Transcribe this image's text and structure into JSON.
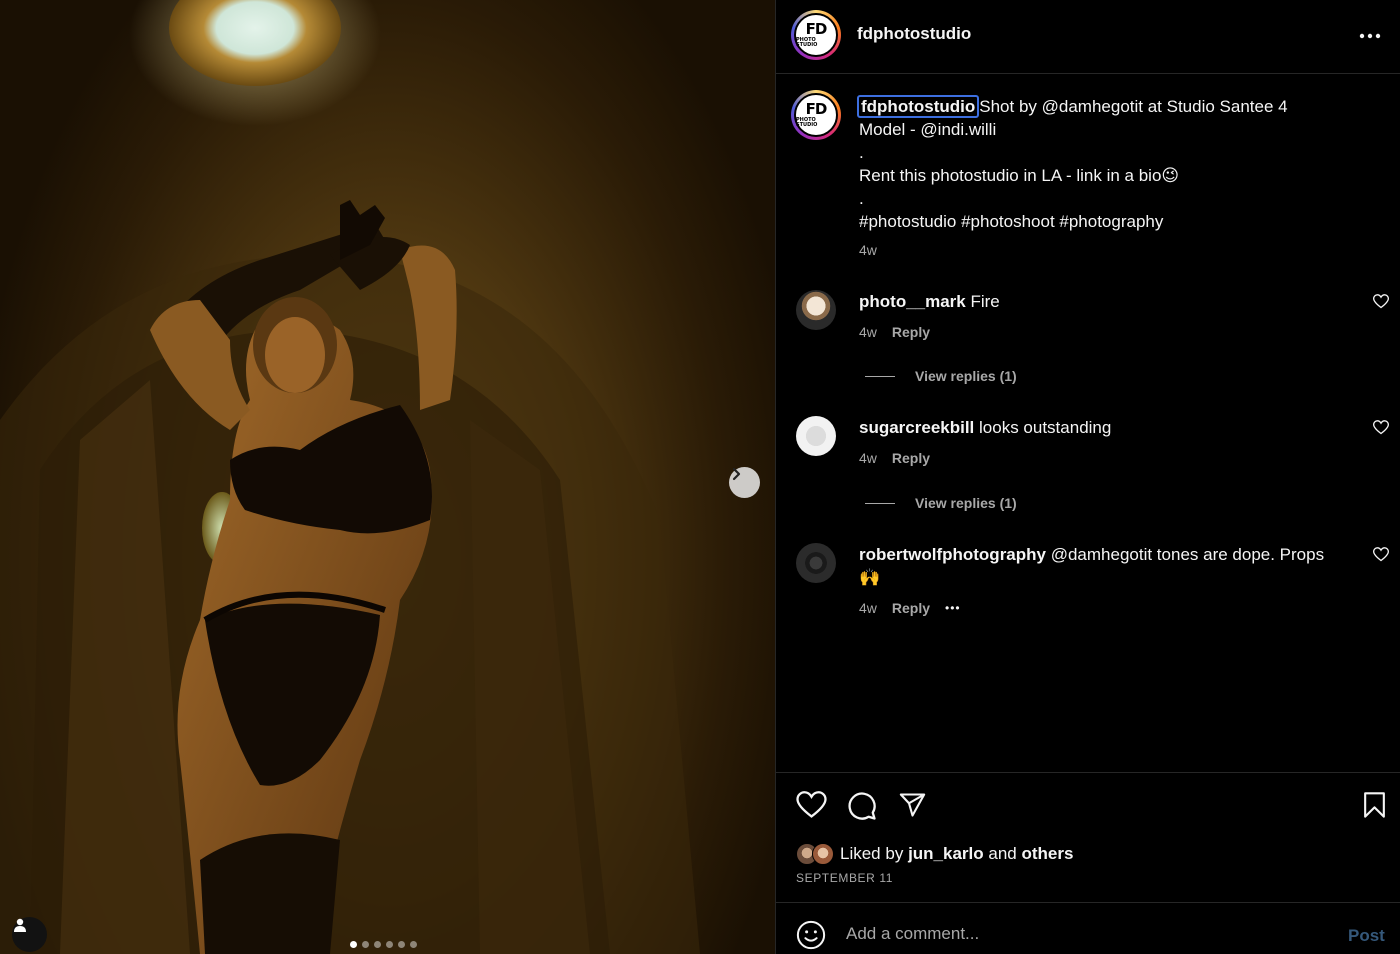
{
  "post": {
    "username": "fdphotostudio",
    "avatar_text_big": "FD",
    "avatar_text_small": "PHOTO STUDIO",
    "caption": {
      "line1": "Shot by @damhegotit at Studio Santee 4",
      "line2": "Model - @indi.willi",
      "line3": ".",
      "line4": "Rent this photostudio in LA - link in a bio😉",
      "line5": ".",
      "line6": "#photostudio #photoshoot #photography",
      "time": "4w"
    }
  },
  "comments": [
    {
      "user": "photo__mark",
      "text": "Fire",
      "time": "4w",
      "reply": "Reply",
      "view_replies": "View replies (1)"
    },
    {
      "user": "sugarcreekbill",
      "text": "looks outstanding",
      "time": "4w",
      "reply": "Reply",
      "view_replies": "View replies (1)"
    },
    {
      "user": "robertwolfphotography",
      "text": "@damhegotit tones are dope. Props 🙌",
      "time": "4w",
      "reply": "Reply",
      "more": "•••"
    }
  ],
  "likes": {
    "prefix": "Liked by",
    "user": "jun_karlo",
    "middle": "and",
    "others": "others"
  },
  "date": "SEPTEMBER 11",
  "add_comment": {
    "placeholder": "Add a comment...",
    "post_label": "Post"
  },
  "carousel": {
    "dot_count": 6,
    "active_index": 0
  },
  "colors": {
    "accent_link": "#35587a",
    "focus_ring": "#3d6fe0",
    "muted": "#a8a8a8"
  },
  "icons": [
    "more-icon",
    "heart-icon",
    "comment-icon",
    "share-icon",
    "bookmark-icon",
    "emoji-icon",
    "chevron-right-icon",
    "user-tag-icon"
  ]
}
